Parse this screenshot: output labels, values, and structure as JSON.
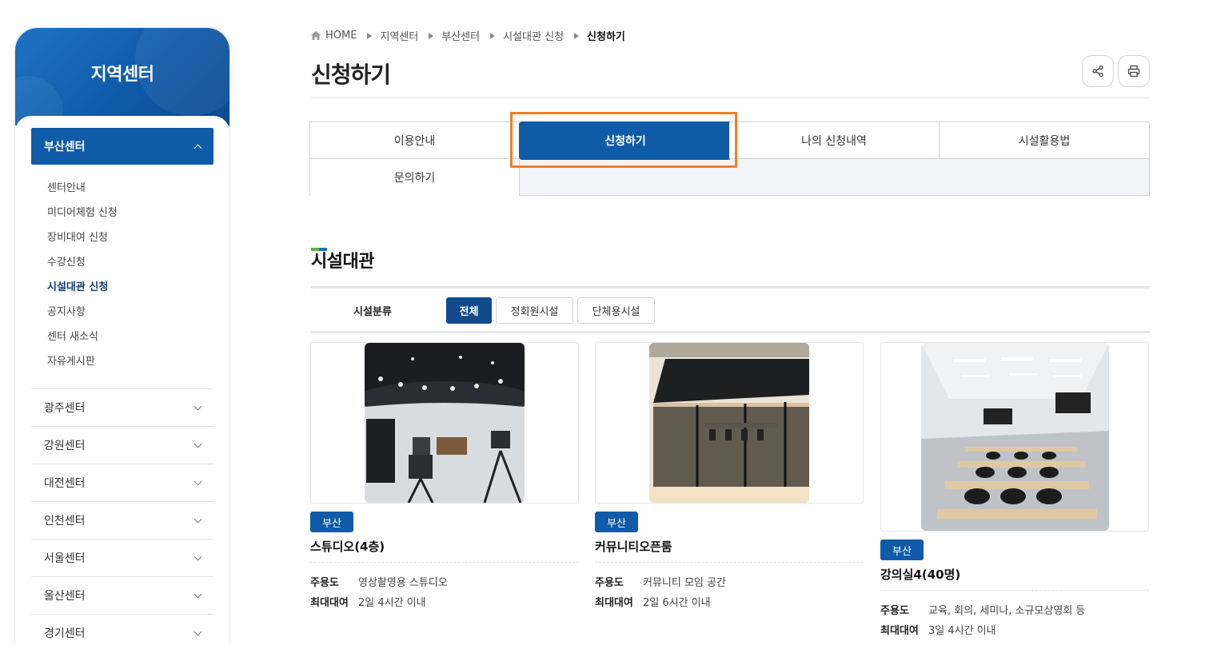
{
  "sidebar": {
    "title": "지역센터",
    "active_group": "부산센터",
    "sub_items": [
      "센터안내",
      "미디어체험 신청",
      "장비대여 신청",
      "수강신청",
      "시설대관 신청",
      "공지사항",
      "센터 새소식",
      "자유게시판"
    ],
    "current_sub_index": 4,
    "groups": [
      "광주센터",
      "강원센터",
      "대전센터",
      "인천센터",
      "서울센터",
      "울산센터",
      "경기센터"
    ]
  },
  "breadcrumb": [
    "HOME",
    "지역센터",
    "부산센터",
    "시설대관 신청",
    "신청하기"
  ],
  "page": {
    "title": "신청하기"
  },
  "toolbar": {
    "share_icon": "share-icon",
    "print_icon": "print-icon"
  },
  "tabs": [
    "이용안내",
    "신청하기",
    "나의 신청내역",
    "시설활용법",
    "문의하기"
  ],
  "active_tab_index": 1,
  "section": {
    "title": "시설대관"
  },
  "filter": {
    "label": "시설분류",
    "options": [
      "전체",
      "정회원시설",
      "단체용시설"
    ],
    "selected_index": 0
  },
  "facilities": [
    {
      "badge": "부산",
      "name": "스튜디오(4층)",
      "purpose_label": "주용도",
      "purpose": "영상촬영용 스튜디오",
      "max_label": "최대대여",
      "max": "2일 4시간 이내"
    },
    {
      "badge": "부산",
      "name": "커뮤니티오픈룸",
      "purpose_label": "주용도",
      "purpose": "커뮤니티 모임 공간",
      "max_label": "최대대여",
      "max": "2일 6시간 이내"
    },
    {
      "badge": "부산",
      "name": "강의실4(40명)",
      "purpose_label": "주용도",
      "purpose": "교육, 회의, 세미나, 소규모상영회 등",
      "max_label": "최대대여",
      "max": "3일 4시간 이내"
    }
  ],
  "colors": {
    "primary": "#0f5ba7",
    "highlight": "#f17f24",
    "mark_green": "#5cb53f",
    "mark_blue": "#1a6fc0"
  }
}
